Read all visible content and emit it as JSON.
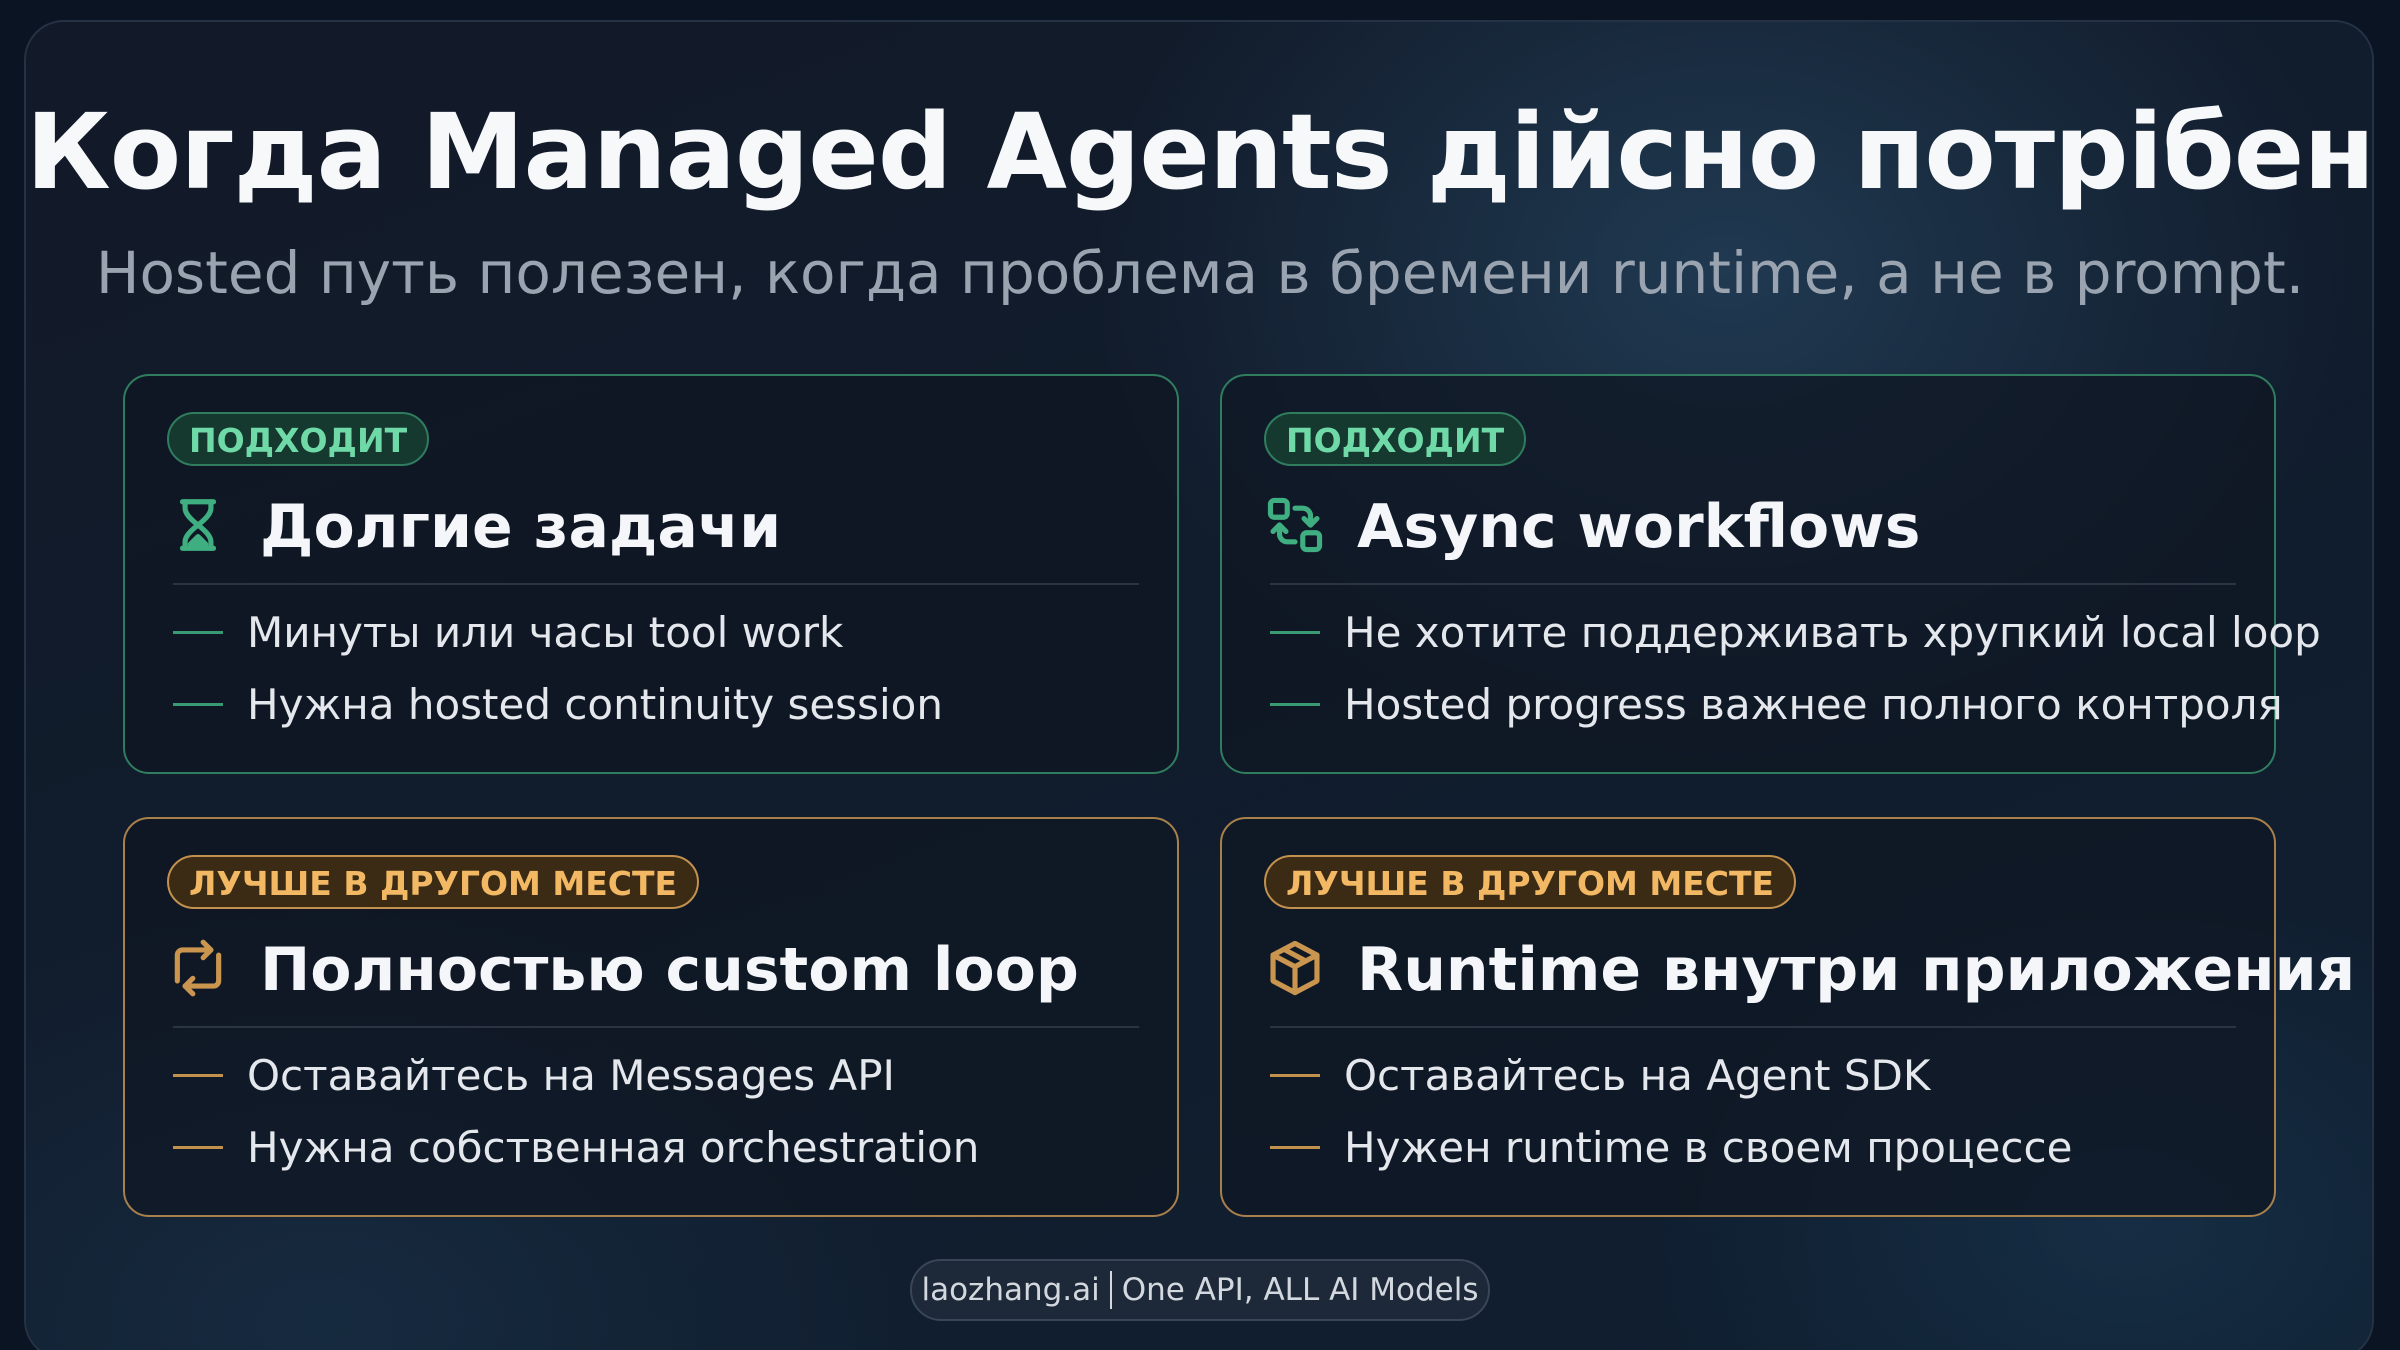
{
  "title": "Когда Managed Agents дійсно потрібен",
  "subtitle": "Hosted путь полезен, когда проблема в бремени runtime, а не в prompt.",
  "colors": {
    "good_accent": "#3a9a72",
    "warn_accent": "#c2914e"
  },
  "cards": [
    {
      "badge": "ПОДХОДИТ",
      "icon": "hourglass-icon",
      "title": "Долгие задачи",
      "bullets": [
        "Минуты или часы tool work",
        "Нужна hosted continuity session"
      ]
    },
    {
      "badge": "ПОДХОДИТ",
      "icon": "workflow-icon",
      "title": "Async workflows",
      "bullets": [
        "Не хотите поддерживать хрупкий local loop",
        "Hosted progress важнее полного контроля"
      ]
    },
    {
      "badge": "ЛУЧШЕ В ДРУГОМ МЕСТЕ",
      "icon": "repeat-icon",
      "title": "Полностью custom loop",
      "bullets": [
        "Оставайтесь на Messages API",
        "Нужна собственная orchestration"
      ]
    },
    {
      "badge": "ЛУЧШЕ В ДРУГОМ МЕСТЕ",
      "icon": "package-icon",
      "title": "Runtime внутри приложения",
      "bullets": [
        "Оставайтесь на Agent SDK",
        "Нужен runtime в своем процессе"
      ]
    }
  ],
  "footer": {
    "brand": "laozhang.ai",
    "tagline": "One API, ALL AI Models"
  }
}
